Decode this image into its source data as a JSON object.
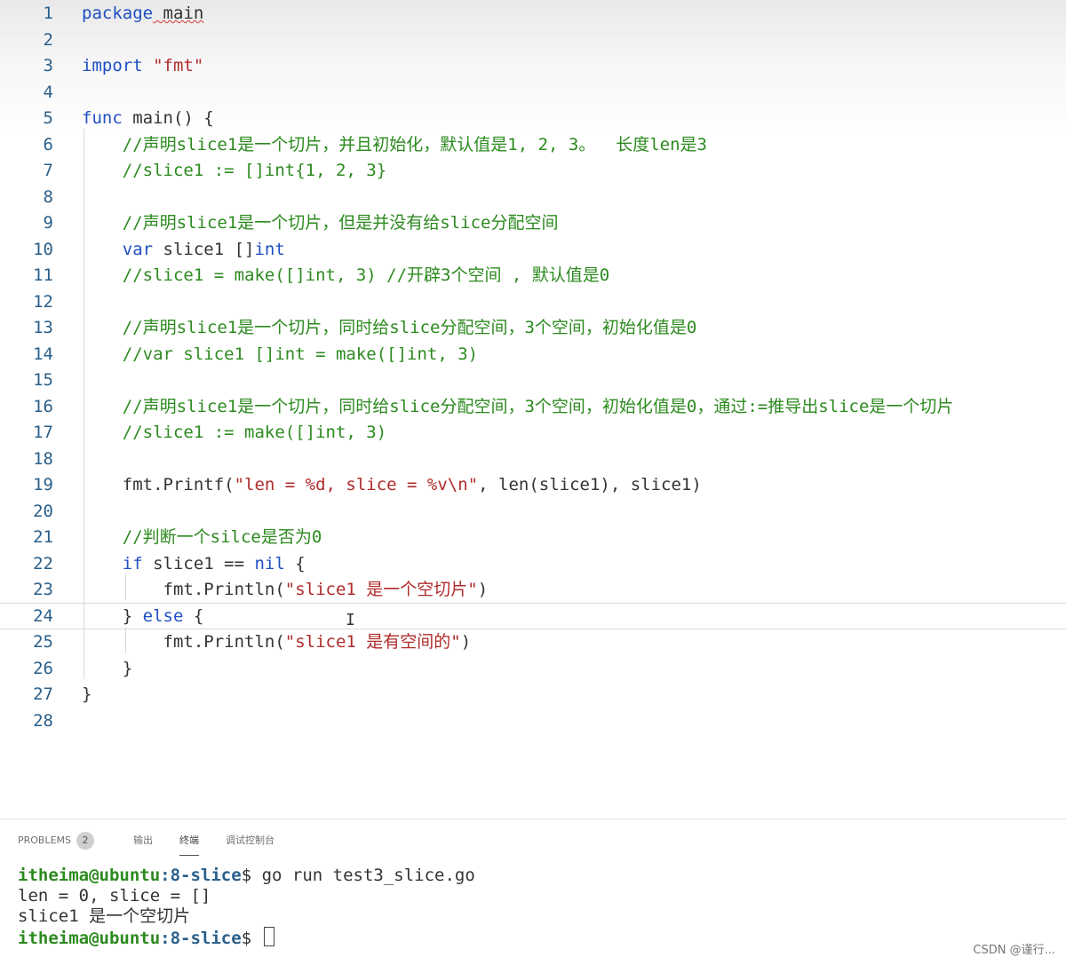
{
  "editor": {
    "lines": [
      {
        "num": "1",
        "parts": [
          [
            "kw",
            "package"
          ],
          [
            "pl",
            " main"
          ]
        ]
      },
      {
        "num": "2",
        "parts": []
      },
      {
        "num": "3",
        "parts": [
          [
            "kw",
            "import"
          ],
          [
            "pl",
            " "
          ],
          [
            "str",
            "\"fmt\""
          ]
        ]
      },
      {
        "num": "4",
        "parts": []
      },
      {
        "num": "5",
        "parts": [
          [
            "kw",
            "func"
          ],
          [
            "pl",
            " main() {"
          ]
        ]
      },
      {
        "num": "6",
        "parts": [
          [
            "cm",
            "    //声明slice1是一个切片，并且初始化，默认值是1, 2, 3。  长度len是3"
          ]
        ]
      },
      {
        "num": "7",
        "parts": [
          [
            "cm",
            "    //slice1 := []int{1, 2, 3}"
          ]
        ]
      },
      {
        "num": "8",
        "parts": []
      },
      {
        "num": "9",
        "parts": [
          [
            "cm",
            "    //声明slice1是一个切片，但是并没有给slice分配空间"
          ]
        ]
      },
      {
        "num": "10",
        "parts": [
          [
            "kw",
            "    var"
          ],
          [
            "pl",
            " slice1 []"
          ],
          [
            "kw",
            "int"
          ]
        ]
      },
      {
        "num": "11",
        "parts": [
          [
            "cm",
            "    //slice1 = make([]int, 3) //开辟3个空间 , 默认值是0"
          ]
        ]
      },
      {
        "num": "12",
        "parts": []
      },
      {
        "num": "13",
        "parts": [
          [
            "cm",
            "    //声明slice1是一个切片，同时给slice分配空间，3个空间，初始化值是0"
          ]
        ]
      },
      {
        "num": "14",
        "parts": [
          [
            "cm",
            "    //var slice1 []int = make([]int, 3)"
          ]
        ]
      },
      {
        "num": "15",
        "parts": []
      },
      {
        "num": "16",
        "parts": [
          [
            "cm",
            "    //声明slice1是一个切片，同时给slice分配空间，3个空间，初始化值是0，通过:=推导出slice是一个切片"
          ]
        ]
      },
      {
        "num": "17",
        "parts": [
          [
            "cm",
            "    //slice1 := make([]int, 3)"
          ]
        ]
      },
      {
        "num": "18",
        "parts": []
      },
      {
        "num": "19",
        "parts": [
          [
            "pl",
            "    fmt.Printf("
          ],
          [
            "str",
            "\"len = %d, slice = %v\\n\""
          ],
          [
            "pl",
            ", len(slice1), slice1)"
          ]
        ]
      },
      {
        "num": "20",
        "parts": []
      },
      {
        "num": "21",
        "parts": [
          [
            "cm",
            "    //判断一个silce是否为0"
          ]
        ]
      },
      {
        "num": "22",
        "parts": [
          [
            "kw",
            "    if"
          ],
          [
            "pl",
            " slice1 == "
          ],
          [
            "kw",
            "nil"
          ],
          [
            "pl",
            " {"
          ]
        ]
      },
      {
        "num": "23",
        "parts": [
          [
            "pl",
            "        fmt.Println("
          ],
          [
            "str",
            "\"slice1 是一个空切片\""
          ],
          [
            "pl",
            ")"
          ]
        ]
      },
      {
        "num": "24",
        "parts": [
          [
            "pl",
            "    } "
          ],
          [
            "kw",
            "else"
          ],
          [
            "pl",
            " {"
          ]
        ]
      },
      {
        "num": "25",
        "parts": [
          [
            "pl",
            "        fmt.Println("
          ],
          [
            "str",
            "\"slice1 是有空间的\""
          ],
          [
            "pl",
            ")"
          ]
        ]
      },
      {
        "num": "26",
        "parts": [
          [
            "pl",
            "    }"
          ]
        ]
      },
      {
        "num": "27",
        "parts": [
          [
            "pl",
            "}"
          ]
        ]
      },
      {
        "num": "28",
        "parts": []
      }
    ]
  },
  "panel": {
    "tabs": [
      {
        "label": "PROBLEMS",
        "badge": "2"
      },
      {
        "label": "输出"
      },
      {
        "label": "终端",
        "active": true
      },
      {
        "label": "调试控制台"
      }
    ]
  },
  "terminal": {
    "prompt_user": "itheima@ubuntu",
    "prompt_path": ":8-slice",
    "prompt_symbol": "$",
    "command": " go run test3_slice.go",
    "output": [
      "len = 0, slice = []",
      "slice1 是一个空切片"
    ]
  },
  "watermark": "CSDN @谨行..."
}
